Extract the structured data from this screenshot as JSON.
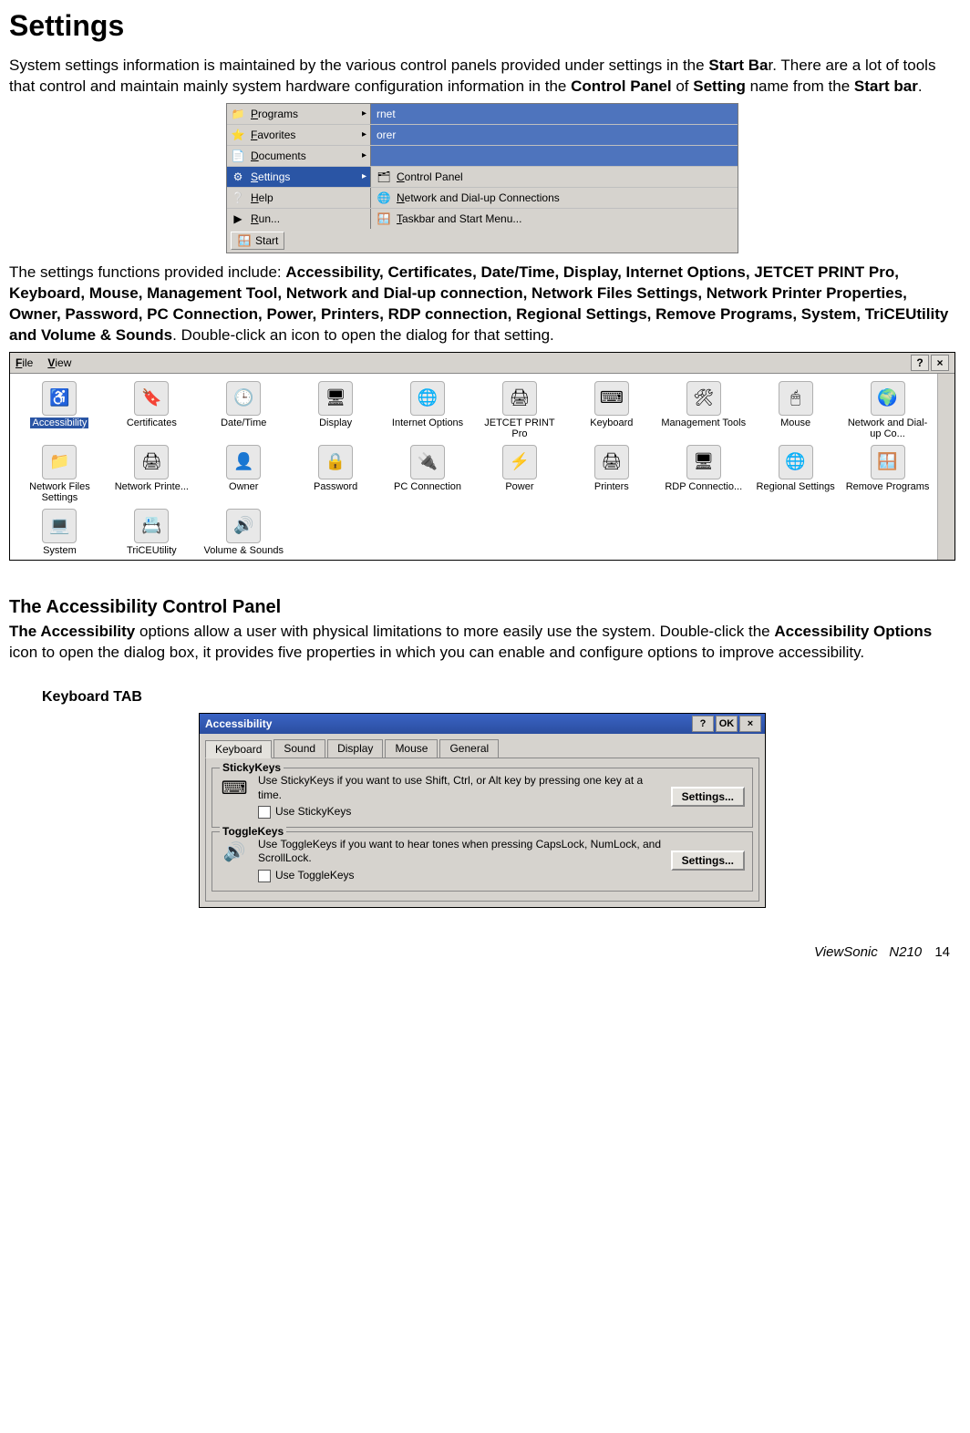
{
  "heading": "Settings",
  "intro_parts": {
    "p1": "System settings information is maintained by the various control panels provided under settings in the ",
    "b1": "Start Ba",
    "p2": "r. There are a lot of tools that control and maintain mainly system hardware configuration information in the ",
    "b2": "Control Panel",
    "p3": " of ",
    "b3": "Setting",
    "p4": " name from the ",
    "b4": "Start bar",
    "p5": "."
  },
  "startmenu": {
    "left": [
      {
        "icon": "📁",
        "label": "Programs",
        "arrow": "▸",
        "sel": false
      },
      {
        "icon": "⭐",
        "label": "Favorites",
        "arrow": "▸",
        "sel": false
      },
      {
        "icon": "📄",
        "label": "Documents",
        "arrow": "▸",
        "sel": false
      },
      {
        "icon": "⚙",
        "label": "Settings",
        "arrow": "▸",
        "sel": true
      },
      {
        "icon": "❔",
        "label": "Help",
        "arrow": "",
        "sel": false
      },
      {
        "icon": "▶",
        "label": "Run...",
        "arrow": "",
        "sel": false
      }
    ],
    "right_top": [
      {
        "label": "rnet"
      },
      {
        "label": "orer"
      }
    ],
    "right": [
      {
        "icon": "🗂",
        "label": "Control Panel"
      },
      {
        "icon": "🌐",
        "label": "Network and Dial-up Connections"
      },
      {
        "icon": "🪟",
        "label": "Taskbar and Start Menu..."
      }
    ],
    "start_label": "Start"
  },
  "functions_intro": "The settings functions provided include: ",
  "functions_bold": "Accessibility, Certificates, Date/Time, Display, Internet Options, JETCET PRINT Pro, Keyboard, Mouse, Management Tool, Network and Dial-up connection, Network Files Settings, Network Printer Properties, Owner, Password, PC Connection, Power, Printers, RDP connection, Regional Settings, Remove Programs, System, TriCEUtility and Volume & Sounds",
  "functions_outro": ". Double-click an icon to open the dialog for that setting.",
  "cp_menu": {
    "file": "File",
    "view": "View"
  },
  "cp_buttons": {
    "help": "?",
    "close": "×"
  },
  "cp_items": [
    {
      "glyph": "♿",
      "label": "Accessibility",
      "sel": true
    },
    {
      "glyph": "🔖",
      "label": "Certificates"
    },
    {
      "glyph": "🕒",
      "label": "Date/Time"
    },
    {
      "glyph": "🖥",
      "label": "Display"
    },
    {
      "glyph": "🌐",
      "label": "Internet Options"
    },
    {
      "glyph": "🖨",
      "label": "JETCET PRINT Pro"
    },
    {
      "glyph": "⌨",
      "label": "Keyboard"
    },
    {
      "glyph": "🛠",
      "label": "Management Tools"
    },
    {
      "glyph": "🖱",
      "label": "Mouse"
    },
    {
      "glyph": "🌍",
      "label": "Network and Dial-up Co..."
    },
    {
      "glyph": "📁",
      "label": "Network Files Settings"
    },
    {
      "glyph": "🖨",
      "label": "Network Printe..."
    },
    {
      "glyph": "👤",
      "label": "Owner"
    },
    {
      "glyph": "🔒",
      "label": "Password"
    },
    {
      "glyph": "🔌",
      "label": "PC Connection"
    },
    {
      "glyph": "⚡",
      "label": "Power"
    },
    {
      "glyph": "🖨",
      "label": "Printers"
    },
    {
      "glyph": "🖥",
      "label": "RDP Connectio..."
    },
    {
      "glyph": "🌐",
      "label": "Regional Settings"
    },
    {
      "glyph": "🪟",
      "label": "Remove Programs"
    },
    {
      "glyph": "💻",
      "label": "System"
    },
    {
      "glyph": "📇",
      "label": "TriCEUtility"
    },
    {
      "glyph": "🔊",
      "label": "Volume & Sounds"
    }
  ],
  "section2_heading": "The Accessibility Control Panel",
  "section2_parts": {
    "b1": "The Accessibility",
    "p1": " options allow a user with physical limitations to more easily use the system. Double-click the ",
    "b2": "Accessibility Options",
    "p2": " icon to open the dialog box, it provides five properties in which you can enable and configure options to improve accessibility."
  },
  "tab_heading": "Keyboard TAB",
  "acc": {
    "title": "Accessibility",
    "buttons": {
      "help": "?",
      "ok": "OK",
      "close": "×"
    },
    "tabs": [
      "Keyboard",
      "Sound",
      "Display",
      "Mouse",
      "General"
    ],
    "sticky": {
      "legend": "StickyKeys",
      "desc": "Use StickyKeys if you want to use Shift, Ctrl, or Alt key by pressing one key at a time.",
      "check": "Use StickyKeys",
      "btn": "Settings..."
    },
    "toggle": {
      "legend": "ToggleKeys",
      "desc": "Use ToggleKeys if you want to hear tones when pressing CapsLock, NumLock, and ScrollLock.",
      "check": "Use ToggleKeys",
      "btn": "Settings..."
    }
  },
  "footer": {
    "brand": "ViewSonic",
    "model": "N210",
    "page": "14"
  }
}
